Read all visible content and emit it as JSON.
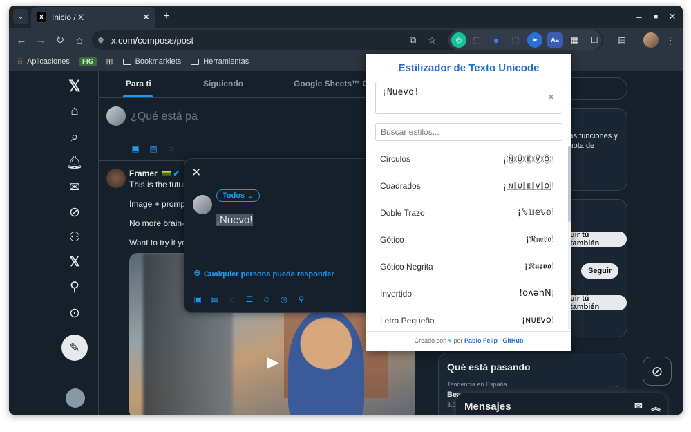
{
  "browser": {
    "tab_title": "Inicio / X",
    "url": "x.com/compose/post",
    "tab_favicon": "X",
    "new_tab_label": "+",
    "ext_translate_label": "Aa",
    "bookmarks": [
      {
        "label": "Aplicaciones"
      },
      {
        "label": "FIG"
      },
      {
        "label": "Bookmarklets"
      },
      {
        "label": "Herramientas"
      }
    ]
  },
  "feed": {
    "tabs": [
      "Para ti",
      "Siguiendo",
      "Google Sheets™ C"
    ],
    "compose_placeholder": "¿Qué está pa",
    "post": {
      "author": "Framer",
      "line1": "This is the futur",
      "line2": "Image + prompt",
      "line3": "No more brain-r",
      "line4": "Want to try it yo"
    }
  },
  "compose_modal": {
    "audience": "Todos",
    "draft_text": "¡Nuevo!",
    "reply_setting": "Cualquier persona puede responder"
  },
  "right": {
    "promo_line1": "vas funciones y,",
    "promo_line2": "cuota de",
    "follow_label_1": "uir tú también",
    "follow_label_2": "Seguir",
    "follow_label_3": "uir tú también",
    "trending_title": "Qué está pasando",
    "trend_meta": "Tendencia en España",
    "trend_name": "Bea",
    "trend_count": "3.0",
    "messages": "Mensajes"
  },
  "popup": {
    "title": "Estilizador de Texto Unicode",
    "input_value": "¡Nuevo!",
    "search_placeholder": "Buscar estilos...",
    "styles": [
      {
        "name": "Círculos",
        "sample": "¡ⓃⓊⒺⓋⓄ!"
      },
      {
        "name": "Cuadrados",
        "sample": "¡🄽🅄🄴🅅🄾!"
      },
      {
        "name": "Doble Trazo",
        "sample": "¡ℕ𝕦𝕖𝕧𝕠!"
      },
      {
        "name": "Gótico",
        "sample": "¡𝔑𝔲𝔢𝔳𝔬!"
      },
      {
        "name": "Gótico Negrita",
        "sample": "¡𝕹𝖚𝖊𝖛𝖔!"
      },
      {
        "name": "Invertido",
        "sample": "!oʌǝnN¡"
      },
      {
        "name": "Letra Pequeña",
        "sample": "¡ɴᴜᴇᴠᴏ!"
      }
    ],
    "footer_prefix": "Creado con",
    "footer_by": "por",
    "footer_author": "Pablo Felip",
    "footer_sep": "|",
    "footer_link": "GitHub"
  },
  "colors": {
    "accent": "#1d9bf0",
    "popup_title": "#2470c9",
    "background": "#15202b"
  }
}
